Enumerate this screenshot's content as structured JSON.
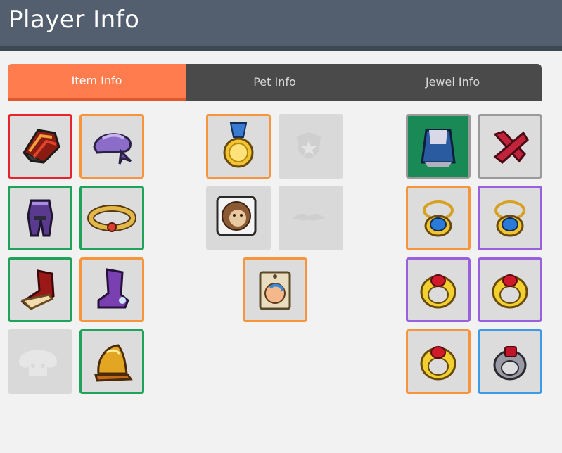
{
  "header": {
    "title": "Player Info"
  },
  "tabs": [
    {
      "label": "Item Info",
      "active": true
    },
    {
      "label": "Pet Info",
      "active": false
    },
    {
      "label": "Jewel Info",
      "active": false
    }
  ],
  "colors": {
    "header": "#535f6e",
    "active_tab": "#ff7c4f",
    "tab_bar": "#4a4a4a",
    "rarity_red": "#e8232b",
    "rarity_orange": "#f7953d",
    "rarity_green": "#1fa35a",
    "rarity_purple": "#9a5fdc",
    "rarity_blue": "#3b9be5",
    "rarity_grey": "#9a9a9a"
  },
  "slots": {
    "equipment": [
      {
        "icon": "shoulder-armor-icon",
        "rarity": "red"
      },
      {
        "icon": "bandana-hat-icon",
        "rarity": "orange"
      },
      {
        "icon": "overall-outfit-icon",
        "rarity": "green"
      },
      {
        "icon": "belt-icon",
        "rarity": "green"
      },
      {
        "icon": "fur-boots-icon",
        "rarity": "green"
      },
      {
        "icon": "purple-boots-icon",
        "rarity": "orange"
      },
      {
        "icon": "empty-mushroom-slot-icon",
        "rarity": "none"
      },
      {
        "icon": "gold-cape-icon",
        "rarity": "green"
      }
    ],
    "pet": [
      {
        "icon": "gold-medal-icon",
        "rarity": "orange"
      },
      {
        "icon": "empty-badge-slot-icon",
        "rarity": "none"
      },
      {
        "icon": "lion-pet-card-icon",
        "rarity": "none"
      },
      {
        "icon": "empty-mustache-slot-icon",
        "rarity": "none"
      },
      {
        "icon": "pet-tag-icon",
        "rarity": "orange"
      }
    ],
    "jewel": [
      {
        "icon": "emblem-cape-icon",
        "rarity": "grey"
      },
      {
        "icon": "broken-item-icon",
        "rarity": "grey"
      },
      {
        "icon": "blue-pendant-icon",
        "rarity": "orange"
      },
      {
        "icon": "blue-pendant-icon",
        "rarity": "purple"
      },
      {
        "icon": "ruby-ring-icon",
        "rarity": "purple"
      },
      {
        "icon": "ruby-ring-icon",
        "rarity": "purple"
      },
      {
        "icon": "ruby-ring-icon",
        "rarity": "orange"
      },
      {
        "icon": "silver-ruby-ring-icon",
        "rarity": "blue"
      }
    ]
  }
}
